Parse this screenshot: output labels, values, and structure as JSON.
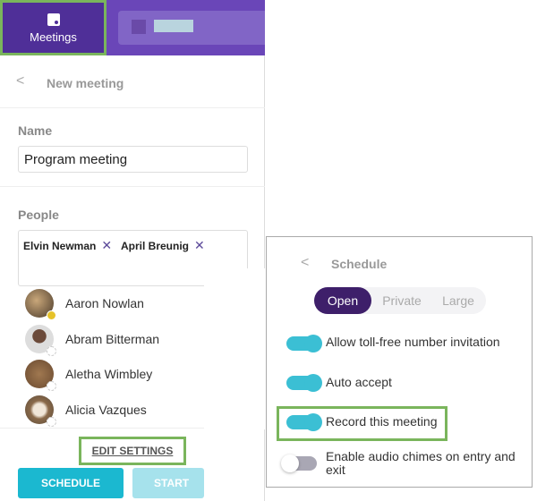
{
  "nav": {
    "meetings_label": "Meetings",
    "calendar_icon": "calendar-icon"
  },
  "new_meeting": {
    "back": "<",
    "title": "New meeting",
    "name_label": "Name",
    "name_value": "Program meeting",
    "people_label": "People",
    "selected": [
      {
        "name": "Elvin Newman",
        "remove": "✕"
      },
      {
        "name": "April Breunig",
        "remove": "✕"
      }
    ],
    "contacts": [
      {
        "name": "Aaron Nowlan",
        "status": "away"
      },
      {
        "name": "Abram Bitterman",
        "status": "offline"
      },
      {
        "name": "Aletha Wimbley",
        "status": "offline"
      },
      {
        "name": "Alicia Vazques",
        "status": "offline"
      }
    ],
    "edit_settings": "EDIT SETTINGS",
    "schedule": "SCHEDULE",
    "start_now": "START NO"
  },
  "schedule": {
    "back": "<",
    "title": "Schedule",
    "modes": [
      "Open",
      "Private",
      "Large"
    ],
    "selected_mode": "Open",
    "options": [
      {
        "label": "Allow toll-free number invitation",
        "on": true
      },
      {
        "label": "Auto accept",
        "on": true
      },
      {
        "label": "Record this meeting",
        "on": true
      },
      {
        "label": "Enable audio chimes on entry and exit",
        "on": false
      }
    ]
  },
  "colors": {
    "header": "#6a46b8",
    "active_tab": "#4f2f98",
    "accent": "#1bb8d0",
    "highlight": "#7ab55c"
  }
}
